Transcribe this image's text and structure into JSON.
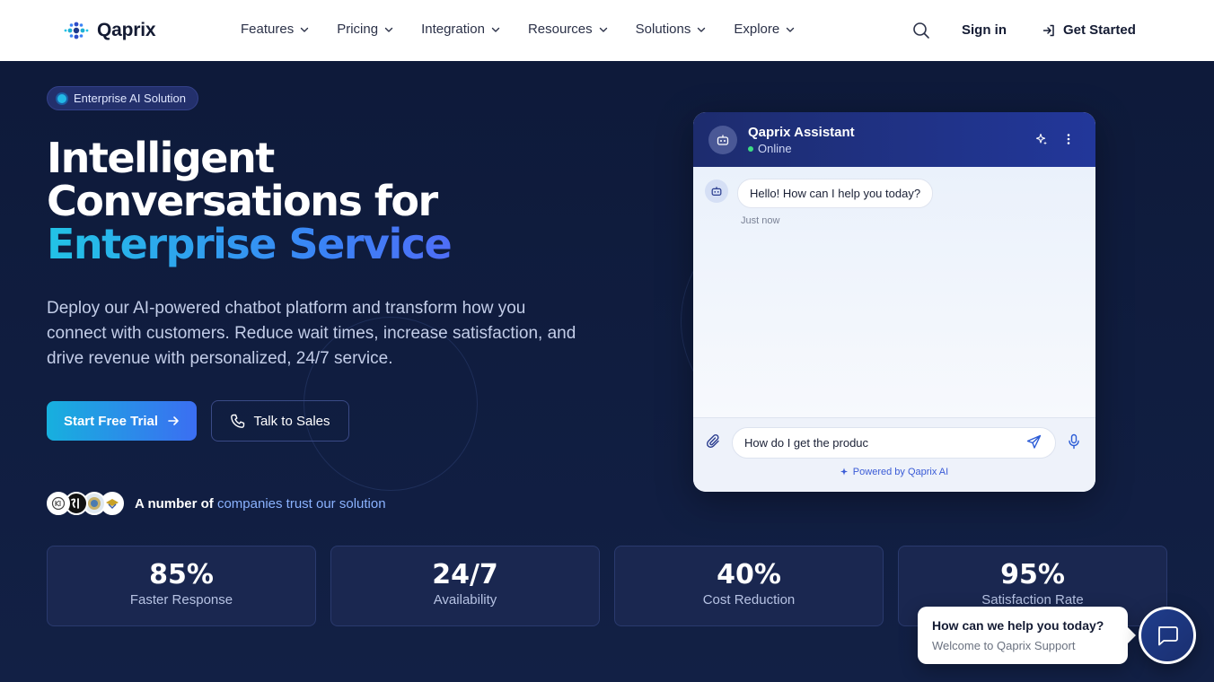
{
  "brand": {
    "name": "Qaprix"
  },
  "nav": {
    "items": [
      {
        "label": "Features"
      },
      {
        "label": "Pricing"
      },
      {
        "label": "Integration"
      },
      {
        "label": "Resources"
      },
      {
        "label": "Solutions"
      },
      {
        "label": "Explore"
      }
    ],
    "sign_in": "Sign in",
    "get_started": "Get Started"
  },
  "hero": {
    "badge": "Enterprise AI Solution",
    "headline_line1": "Intelligent",
    "headline_line2": "Conversations for",
    "headline_highlight": "Enterprise Service",
    "subtitle": "Deploy our AI-powered chatbot platform and transform how you connect with customers. Reduce wait times, increase satisfaction, and drive revenue with personalized, 24/7 service.",
    "primary_cta": "Start Free Trial",
    "secondary_cta": "Talk to Sales",
    "trust_prefix": "A number of",
    "trust_link": "companies trust our solution"
  },
  "chat": {
    "title": "Qaprix Assistant",
    "status": "Online",
    "messages": [
      {
        "text": "Hello! How can I help you today?",
        "time": "Just now"
      }
    ],
    "input_value": "How do I get the produc",
    "powered_by": "Powered by Qaprix AI"
  },
  "stats": [
    {
      "value": "85%",
      "label": "Faster Response"
    },
    {
      "value": "24/7",
      "label": "Availability"
    },
    {
      "value": "40%",
      "label": "Cost Reduction"
    },
    {
      "value": "95%",
      "label": "Satisfaction Rate"
    }
  ],
  "support": {
    "title": "How can we help you today?",
    "subtitle": "Welcome to Qaprix Support"
  },
  "colors": {
    "brand_gradient_start": "#22c3e6",
    "brand_gradient_end": "#4f6ef7",
    "hero_bg": "#0f1b3d",
    "online": "#3ddc84"
  }
}
